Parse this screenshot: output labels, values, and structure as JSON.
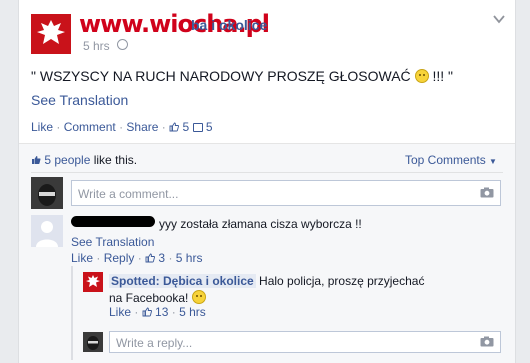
{
  "watermark": "www.wiocha.pl",
  "post": {
    "page_name": "ba i okolice",
    "time": "5 hrs",
    "text": "\" WSZYSCY NA RUCH NARODOWY PROSZĘ GŁOSOWAĆ",
    "text_end": " !!! \"",
    "see_translation": "See Translation",
    "actions": {
      "like": "Like",
      "comment": "Comment",
      "share": "Share",
      "likes_count": "5",
      "shares_count": "5"
    }
  },
  "ufi": {
    "likes_line": "5 people",
    "likes_line_suffix": " like this.",
    "top_comments": "Top Comments",
    "composer_placeholder": "Write a comment...",
    "comments": [
      {
        "text": "yyy została złamana cisza wyborcza !!",
        "see_translation": "See Translation",
        "like": "Like",
        "reply": "Reply",
        "like_count": "3",
        "time": "5 hrs"
      }
    ],
    "replies": [
      {
        "author": "Spotted: Dębica i okolice",
        "text": "Halo policja, proszę przyjechać na Facebooka!",
        "like": "Like",
        "like_count": "13",
        "time": "5 hrs"
      }
    ],
    "reply_placeholder": "Write a reply..."
  },
  "colors": {
    "link": "#3b5998",
    "muted": "#9197a3",
    "brand_red": "#c9121a"
  },
  "icons": [
    "eagle-logo-icon",
    "globe-icon",
    "chevron-down-icon",
    "thumbs-up-icon",
    "share-icon",
    "camera-icon",
    "smiley-icon"
  ]
}
